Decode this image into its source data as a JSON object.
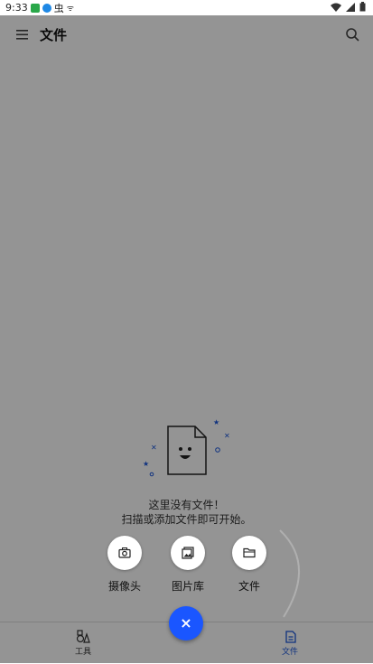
{
  "status_bar": {
    "time": "9:33",
    "app_badge_colors": [
      "#2aa84a",
      "#1e88e5"
    ],
    "notification_glyphs": [
      "虫",
      "ᯤ"
    ]
  },
  "header": {
    "title": "文件",
    "menu_icon": "hamburger-icon",
    "search_icon": "search-icon"
  },
  "empty_state": {
    "line1": "这里没有文件！",
    "line2": "扫描或添加文件即可开始。",
    "illustration": "smiling-document-icon"
  },
  "fab_menu": {
    "actions": [
      {
        "label": "摄像头",
        "icon": "camera-icon"
      },
      {
        "label": "图片库",
        "icon": "gallery-icon"
      },
      {
        "label": "文件",
        "icon": "folder-icon"
      }
    ],
    "main_icon": "close-icon",
    "main_glyph": "×",
    "accent_color": "#1a56ff"
  },
  "bottom_nav": {
    "items": [
      {
        "label": "工具",
        "icon": "tools-icon",
        "active": false
      },
      {
        "label": "文件",
        "icon": "files-icon",
        "active": true
      }
    ],
    "active_color": "#1a56db"
  }
}
